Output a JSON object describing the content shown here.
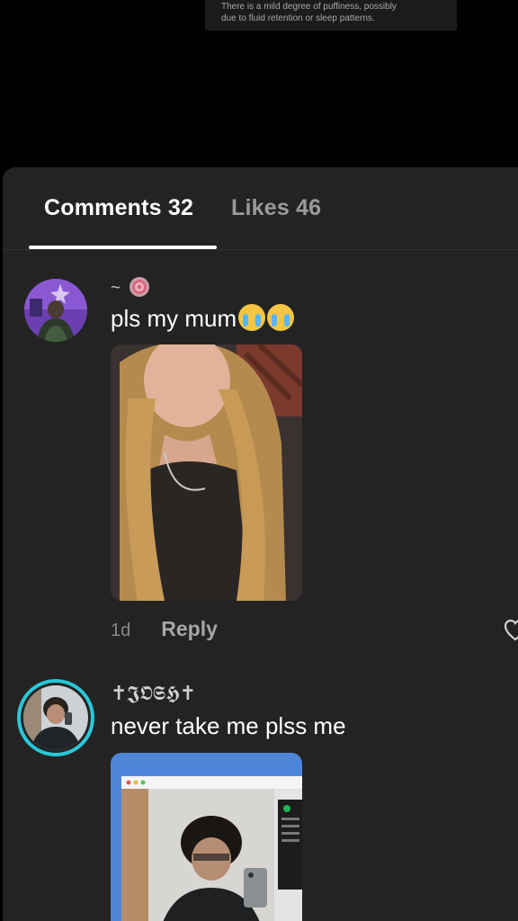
{
  "video_caption": {
    "line1": "There is a mild degree of puffiness, possibly",
    "line2": "due to fluid retention or sleep patterns."
  },
  "tabs": [
    {
      "label": "Comments 32",
      "active": true
    },
    {
      "label": "Likes 46",
      "active": false
    }
  ],
  "comments": [
    {
      "username": "~",
      "text": "pls my mum",
      "emoji": [
        "loudly-crying-face-icon",
        "loudly-crying-face-icon"
      ],
      "time": "1d",
      "reply_label": "Reply"
    },
    {
      "username": "✝𝕵𝕺𝕾𝕳✝",
      "text": "never take me plss me"
    }
  ],
  "colors": {
    "sheet_bg": "#232323",
    "active_tab": "#ffffff",
    "inactive_tab": "#9a9a9a",
    "story_ring": "#29c8d8"
  }
}
